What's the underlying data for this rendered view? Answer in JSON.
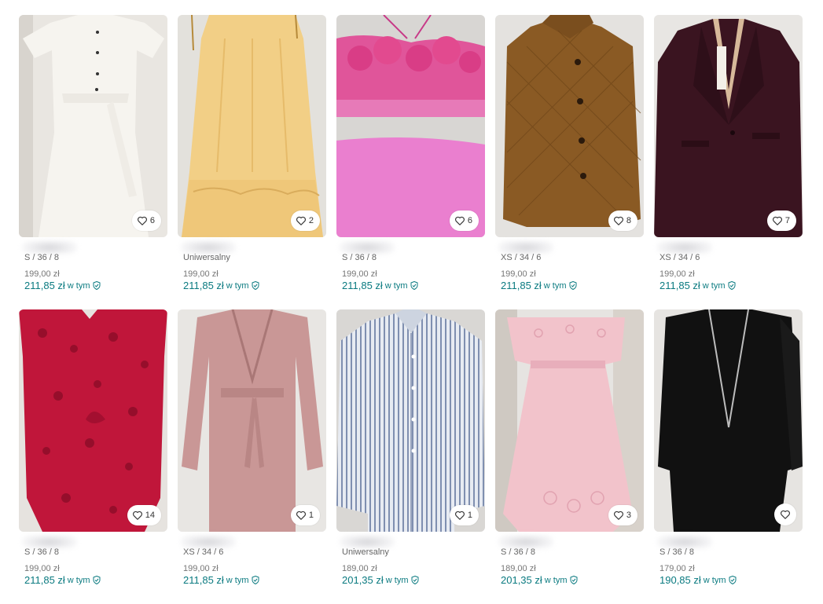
{
  "items": [
    {
      "size": "S / 36 / 8",
      "price": "199,00 zł",
      "total": "211,85 zł",
      "incl": "w tym",
      "likes": "6",
      "img": "white-dress"
    },
    {
      "size": "Uniwersalny",
      "price": "199,00 zł",
      "total": "211,85 zł",
      "incl": "w tym",
      "likes": "2",
      "img": "yellow-dress"
    },
    {
      "size": "S / 36 / 8",
      "price": "199,00 zł",
      "total": "211,85 zł",
      "incl": "w tym",
      "likes": "6",
      "img": "pink-bikini"
    },
    {
      "size": "XS / 34 / 6",
      "price": "199,00 zł",
      "total": "211,85 zł",
      "incl": "w tym",
      "likes": "8",
      "img": "brown-jacket"
    },
    {
      "size": "XS / 34 / 6",
      "price": "199,00 zł",
      "total": "211,85 zł",
      "incl": "w tym",
      "likes": "7",
      "img": "burgundy-blazer"
    },
    {
      "size": "S / 36 / 8",
      "price": "199,00 zł",
      "total": "211,85 zł",
      "incl": "w tym",
      "likes": "14",
      "img": "red-dress"
    },
    {
      "size": "XS / 34 / 6",
      "price": "199,00 zł",
      "total": "211,85 zł",
      "incl": "w tym",
      "likes": "1",
      "img": "rose-wrap-dress"
    },
    {
      "size": "Uniwersalny",
      "price": "189,00 zł",
      "total": "201,35 zł",
      "incl": "w tym",
      "likes": "1",
      "img": "striped-shirt"
    },
    {
      "size": "S / 36 / 8",
      "price": "189,00 zł",
      "total": "201,35 zł",
      "incl": "w tym",
      "likes": "3",
      "img": "pink-eyelet-dress"
    },
    {
      "size": "S / 36 / 8",
      "price": "179,00 zł",
      "total": "190,85 zł",
      "incl": "w tym",
      "likes": "",
      "img": "black-dress"
    }
  ],
  "colors": {
    "accent": "#0a7a80",
    "price_muted": "#777777",
    "size_muted": "#666666"
  },
  "icons": {
    "favorite": "heart-outline-icon",
    "protection": "shield-check-icon"
  }
}
